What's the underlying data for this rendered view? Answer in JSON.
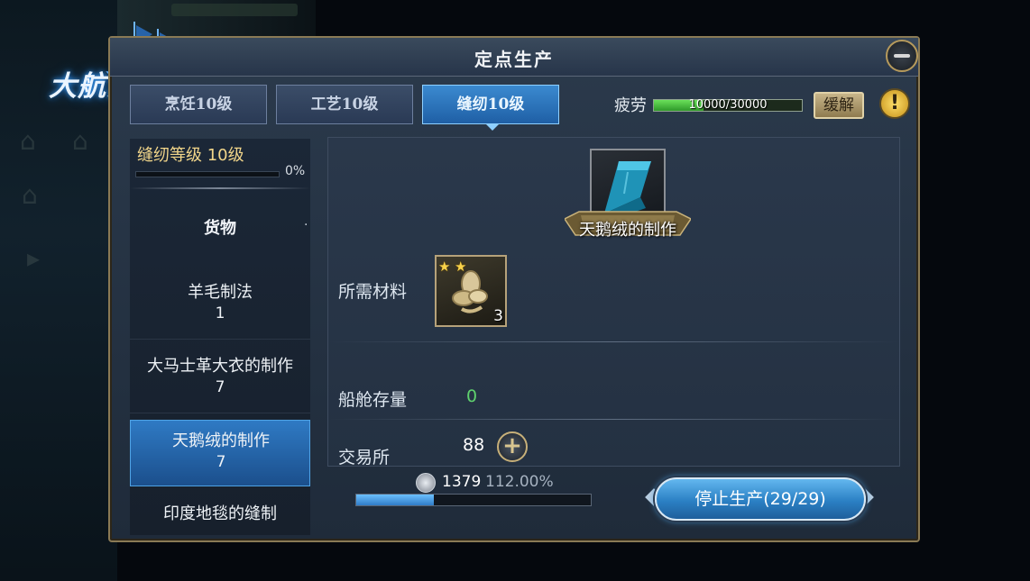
{
  "logo": {
    "text": "大航海之路"
  },
  "window": {
    "title": "定点生产"
  },
  "tabs": [
    {
      "label": "烹饪10级",
      "active": false
    },
    {
      "label": "工艺10级",
      "active": false
    },
    {
      "label": "缝纫10级",
      "active": true
    }
  ],
  "fatigue": {
    "label": "疲劳",
    "value_text": "10000/30000",
    "fraction": 0.3333
  },
  "relieve_button": {
    "label": "缓解"
  },
  "info_button": {
    "label": "!"
  },
  "skill": {
    "level_text": "缝纫等级 10级",
    "percent": "0%"
  },
  "goods_list": {
    "header": "货物",
    "marker": "·",
    "items": [
      {
        "name": "羊毛制法",
        "count": "1"
      },
      {
        "name": "大马士革大衣的制作",
        "count": "7"
      },
      {
        "name": "天鹅绒的制作",
        "count": "7",
        "selected": true
      },
      {
        "name": "印度地毯的缝制",
        "count": ""
      }
    ]
  },
  "product": {
    "name": "天鹅绒的制作",
    "icon": "velvet-fabric-icon",
    "materials_label": "所需材料",
    "material": {
      "icon": "yarn-icon",
      "count": "3",
      "stars": 2
    },
    "stock_label": "船舱存量",
    "stock_value": "0",
    "market_label": "交易所",
    "market_qty": "88",
    "price": "1379",
    "price_percent": "112.00%"
  },
  "production": {
    "progress": 0.33,
    "stop_label": "停止生产(29/29)"
  },
  "colors": {
    "accent": "#2f7ac4",
    "gold": "#f2d68a",
    "stock_green": "#5fd16e"
  }
}
